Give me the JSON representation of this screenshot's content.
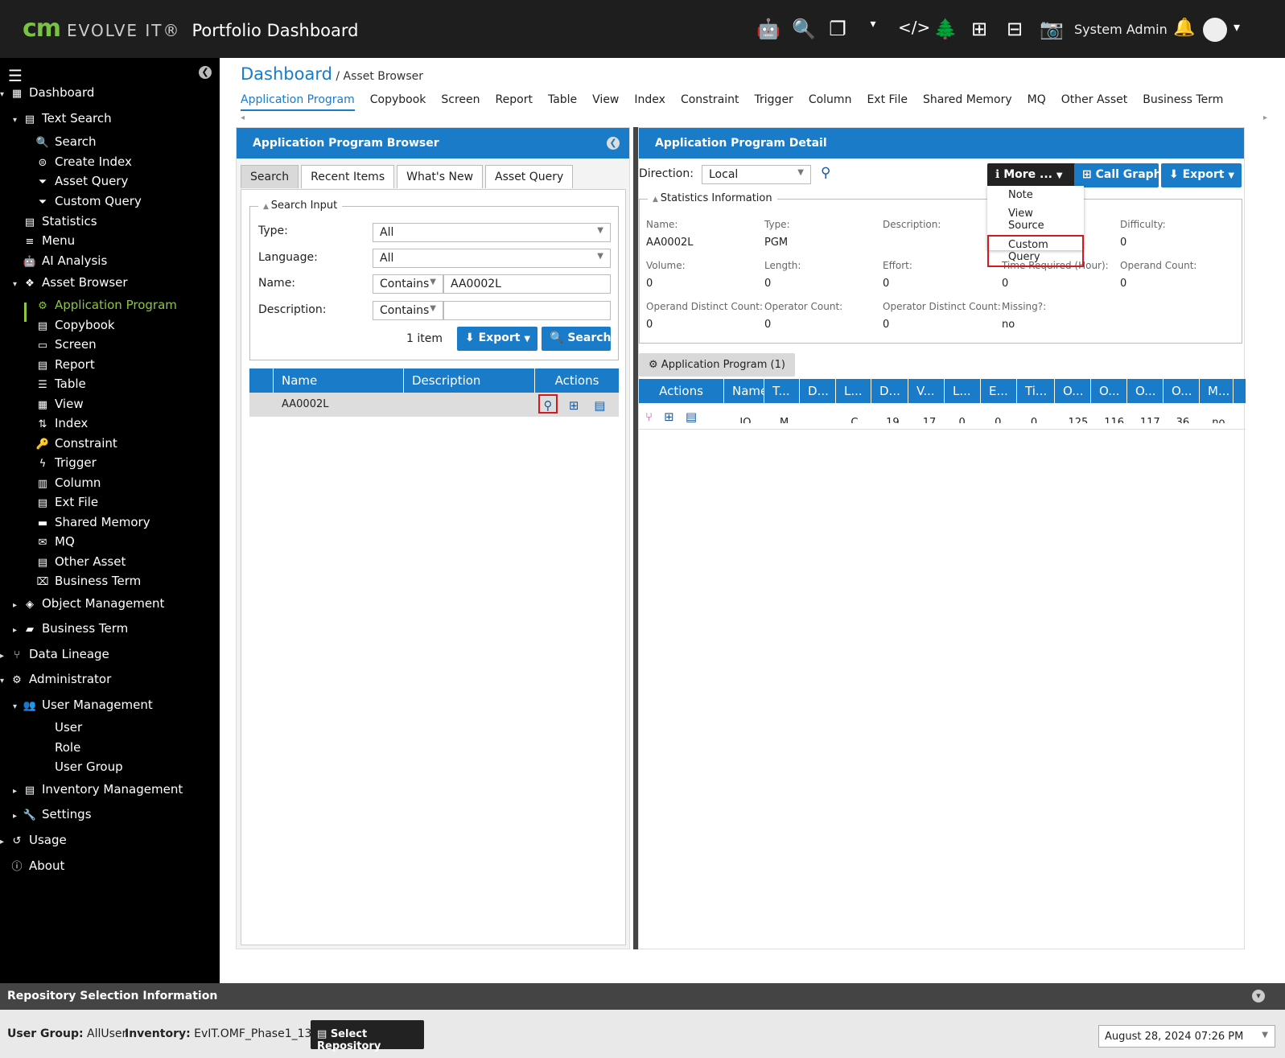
{
  "header": {
    "logo_cm": "cm",
    "logo_evolve": "EVOLVE IT®",
    "app_title": "Portfolio Dashboard",
    "user_name": "System Admin",
    "icons": [
      "robot-icon",
      "search-icon",
      "window-icon",
      "code-icon",
      "tree-icon",
      "sitemap-icon",
      "flow-icon",
      "camera-icon",
      "bell-icon",
      "user-icon"
    ]
  },
  "sidebar": {
    "items": [
      {
        "label": "Dashboard",
        "icon": "dashboard-icon"
      },
      {
        "label": "Text Search",
        "icon": "text-search-icon"
      },
      {
        "label": "Search",
        "icon": "search-icon"
      },
      {
        "label": "Create Index",
        "icon": "create-index-icon"
      },
      {
        "label": "Asset Query",
        "icon": "filter-icon"
      },
      {
        "label": "Custom Query",
        "icon": "filter-icon"
      },
      {
        "label": "Statistics",
        "icon": "statistics-icon"
      },
      {
        "label": "Menu",
        "icon": "menu-icon"
      },
      {
        "label": "AI Analysis",
        "icon": "robot-icon"
      },
      {
        "label": "Asset Browser",
        "icon": "asset-browser-icon"
      },
      {
        "label": "Application Program",
        "icon": "gear-icon"
      },
      {
        "label": "Copybook",
        "icon": "copybook-icon"
      },
      {
        "label": "Screen",
        "icon": "screen-icon"
      },
      {
        "label": "Report",
        "icon": "report-icon"
      },
      {
        "label": "Table",
        "icon": "table-icon"
      },
      {
        "label": "View",
        "icon": "view-icon"
      },
      {
        "label": "Index",
        "icon": "index-icon"
      },
      {
        "label": "Constraint",
        "icon": "key-icon"
      },
      {
        "label": "Trigger",
        "icon": "bolt-icon"
      },
      {
        "label": "Column",
        "icon": "column-icon"
      },
      {
        "label": "Ext File",
        "icon": "file-icon"
      },
      {
        "label": "Shared Memory",
        "icon": "memory-icon"
      },
      {
        "label": "MQ",
        "icon": "mq-icon"
      },
      {
        "label": "Other Asset",
        "icon": "other-asset-icon"
      },
      {
        "label": "Business Term",
        "icon": "business-term-icon"
      },
      {
        "label": "Object Management",
        "icon": "cube-icon"
      },
      {
        "label": "Business Term",
        "icon": "briefcase-icon"
      },
      {
        "label": "Data Lineage",
        "icon": "lineage-icon"
      },
      {
        "label": "Administrator",
        "icon": "cogs-icon"
      },
      {
        "label": "User Management",
        "icon": "users-icon"
      },
      {
        "label": "User",
        "icon": ""
      },
      {
        "label": "Role",
        "icon": ""
      },
      {
        "label": "User Group",
        "icon": ""
      },
      {
        "label": "Inventory Management",
        "icon": "inventory-icon"
      },
      {
        "label": "Settings",
        "icon": "wrench-icon"
      },
      {
        "label": "Usage",
        "icon": "history-icon"
      },
      {
        "label": "About",
        "icon": "info-icon"
      }
    ]
  },
  "breadcrumb": {
    "root": "Dashboard",
    "current": "/ Asset Browser"
  },
  "asset_tabs": [
    "Application Program",
    "Copybook",
    "Screen",
    "Report",
    "Table",
    "View",
    "Index",
    "Constraint",
    "Trigger",
    "Column",
    "Ext File",
    "Shared Memory",
    "MQ",
    "Other Asset",
    "Business Term"
  ],
  "browser": {
    "title": "Application Program Browser",
    "subtabs": [
      "Search",
      "Recent Items",
      "What's New",
      "Asset Query"
    ],
    "search_input_label": "Search Input",
    "type_label": "Type:",
    "type_value": "All",
    "language_label": "Language:",
    "language_value": "All",
    "name_label": "Name:",
    "name_op": "Contains",
    "name_value": "AA0002L",
    "desc_label": "Description:",
    "desc_op": "Contains",
    "desc_value": "",
    "item_count": "1 item",
    "export_label": "Export",
    "search_label": "Search",
    "columns": [
      "Name",
      "Description",
      "Actions"
    ],
    "rows": [
      {
        "name": "AA0002L",
        "description": ""
      }
    ]
  },
  "detail": {
    "title": "Application Program Detail",
    "direction_label": "Direction:",
    "direction_value": "Local",
    "more_label": "More ...",
    "callgraph_label": "Call Graph",
    "export_label": "Export",
    "menu": [
      "Note",
      "View Source",
      "Custom Query"
    ],
    "stats_label": "Statistics Information",
    "stats": [
      {
        "label": "Name:",
        "value": "AA0002L"
      },
      {
        "label": "Type:",
        "value": "PGM"
      },
      {
        "label": "Description:",
        "value": ""
      },
      {
        "label": "Difficulty:",
        "value": "0"
      },
      {
        "label": "Volume:",
        "value": "0"
      },
      {
        "label": "Length:",
        "value": "0"
      },
      {
        "label": "Effort:",
        "value": "0"
      },
      {
        "label": "Time Required (Hour):",
        "value": "0"
      },
      {
        "label": "Operand Count:",
        "value": "0"
      },
      {
        "label": "Operand Distinct Count:",
        "value": "0"
      },
      {
        "label": "Operator Count:",
        "value": "0"
      },
      {
        "label": "Operator Distinct Count:",
        "value": "0"
      },
      {
        "label": "Missing?:",
        "value": "no"
      }
    ],
    "ap_tab": "Application Program (1)",
    "ap_columns": [
      "Actions",
      "Name",
      "T...",
      "D...",
      "L...",
      "D...",
      "V...",
      "L...",
      "E...",
      "Ti...",
      "O...",
      "O...",
      "O...",
      "O...",
      "M..."
    ],
    "ap_row": [
      "IO...",
      "M...",
      "",
      "C...",
      "19...",
      "17...",
      "0",
      "0",
      "0",
      "125",
      "116",
      "117",
      "36",
      "no"
    ]
  },
  "footer": {
    "title": "Repository Selection Information",
    "user_group_label": "User Group:",
    "user_group_value": "AllUser",
    "inventory_label": "Inventory:",
    "inventory_value": "EvIT.OMF_Phase1_13",
    "select_repo_label": "Select Repository",
    "datetime": "August 28, 2024 07:26 PM"
  }
}
